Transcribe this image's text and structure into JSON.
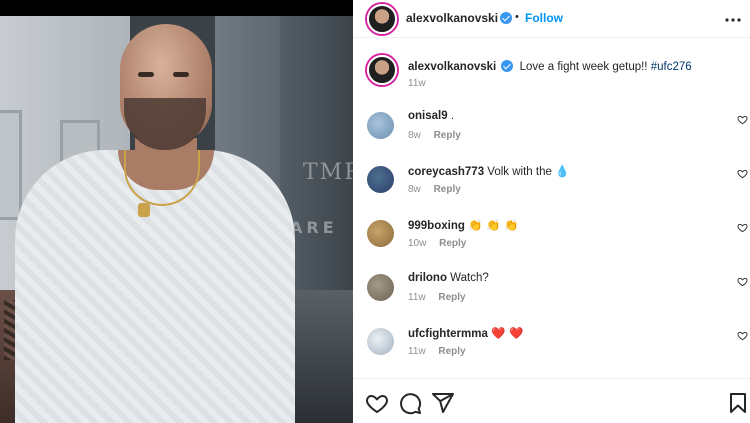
{
  "post": {
    "author": "alexvolkanovski",
    "follow_label": "Follow",
    "separator": "•",
    "more_label": "•••",
    "caption": {
      "text": "Love a fight week getup!!",
      "hashtag": "#ufc276",
      "time": "11w"
    }
  },
  "comments": [
    {
      "user": "onisal9",
      "text": ".",
      "time": "8w",
      "reply_label": "Reply",
      "avatar_color": "#6b8fb0"
    },
    {
      "user": "coreycash773",
      "text": "Volk with the",
      "emoji": "💧",
      "time": "8w",
      "reply_label": "Reply",
      "avatar_color": "#2f3f6b"
    },
    {
      "user": "999boxing",
      "text": "",
      "emoji": "👏 👏 👏",
      "time": "10w",
      "reply_label": "Reply",
      "avatar_color": "#8a6a3a"
    },
    {
      "user": "drilono",
      "text": "Watch?",
      "time": "11w",
      "reply_label": "Reply",
      "avatar_color": "#6d6254"
    },
    {
      "user": "ufcfightermma",
      "text": "",
      "emoji": "❤️ ❤️",
      "time": "11w",
      "reply_label": "Reply",
      "avatar_color": "#c9d3dc"
    }
  ],
  "icons": {
    "verified": "verified-badge-icon",
    "like": "heart-icon",
    "comment": "comment-bubble-icon",
    "share": "paper-plane-icon",
    "save": "bookmark-icon"
  },
  "colors": {
    "accent": "#0095f6",
    "verified": "#3897f0",
    "hashtag": "#00376b",
    "muted": "#8e8e8e"
  }
}
